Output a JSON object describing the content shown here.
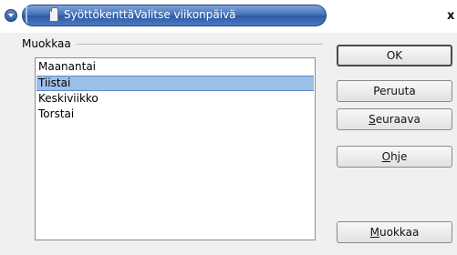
{
  "window": {
    "title": "SyöttökenttäValitse viikonpäivä",
    "close_glyph": "x"
  },
  "group": {
    "label": "Muokkaa"
  },
  "list": {
    "items": [
      {
        "label": "Maanantai",
        "selected": false
      },
      {
        "label": "Tiistai",
        "selected": true
      },
      {
        "label": "Keskiviikko",
        "selected": false
      },
      {
        "label": "Torstai",
        "selected": false
      }
    ]
  },
  "buttons": {
    "ok": "OK",
    "cancel": "Peruuta",
    "next_mnemonic": "S",
    "next_rest": "euraava",
    "help_mnemonic": "O",
    "help_rest": "hje",
    "edit_mnemonic": "M",
    "edit_rest": "uokkaa"
  },
  "colors": {
    "titlebar_blue": "#3e6db5",
    "selection": "#9bbfe8"
  }
}
